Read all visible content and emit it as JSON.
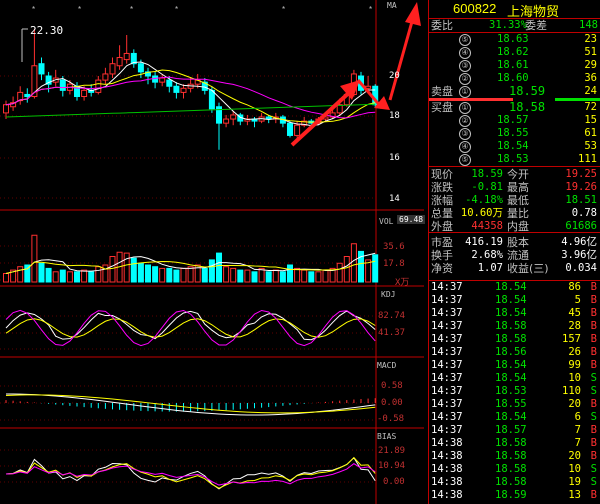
{
  "stock": {
    "code": "600822",
    "name": "上海物贸"
  },
  "chart": {
    "ma_label": "MA",
    "high_marker": "22.30",
    "price_axis": [
      "20",
      "18",
      "16",
      "14"
    ],
    "vol_label": "VOL",
    "vol_value": "69.48",
    "vol_axis": [
      "35.6",
      "17.8"
    ],
    "vol_unit": "X万",
    "kdj_label": "KDJ",
    "kdj_axis": [
      "82.74",
      "41.37"
    ],
    "macd_label": "MACD",
    "macd_axis": [
      "0.58",
      "0.00",
      "-0.58"
    ],
    "bias_label": "BIAS",
    "bias_axis": [
      "21.89",
      "10.94",
      "0.00"
    ],
    "accent_colors": {
      "up": "#ff3030",
      "down": "#00ffff",
      "ma5": "#ffffff",
      "ma10": "#ffff00",
      "ma20": "#ff00ff",
      "ma60": "#00c000"
    }
  },
  "order_book": {
    "weibi_label": "委比",
    "weibi": "31.33%",
    "weicha_label": "委差",
    "weicha": "148",
    "sell_label": "卖盘",
    "buy_label": "买盘",
    "asks": [
      {
        "level": "⑤",
        "price": "18.63",
        "vol": "23"
      },
      {
        "level": "④",
        "price": "18.62",
        "vol": "51"
      },
      {
        "level": "③",
        "price": "18.61",
        "vol": "29"
      },
      {
        "level": "②",
        "price": "18.60",
        "vol": "36"
      },
      {
        "level": "①",
        "price": "18.59",
        "vol": "24"
      }
    ],
    "bids": [
      {
        "level": "①",
        "price": "18.58",
        "vol": "72"
      },
      {
        "level": "②",
        "price": "18.57",
        "vol": "15"
      },
      {
        "level": "③",
        "price": "18.55",
        "vol": "61"
      },
      {
        "level": "④",
        "price": "18.54",
        "vol": "53"
      },
      {
        "level": "⑤",
        "price": "18.53",
        "vol": "111"
      }
    ]
  },
  "quote": {
    "xianjia_label": "现价",
    "xianjia": "18.59",
    "jinkai_label": "今开",
    "jinkai": "19.25",
    "zhangdie_label": "涨跌",
    "zhangdie": "-0.81",
    "zuigao_label": "最高",
    "zuigao": "19.26",
    "zhangfu_label": "涨幅",
    "zhangfu": "-4.18%",
    "zuidi_label": "最低",
    "zuidi": "18.51",
    "zongliang_label": "总量",
    "zongliang": "10.60万",
    "liangbi_label": "量比",
    "liangbi": "0.78",
    "waipan_label": "外盘",
    "waipan": "44358",
    "neipan_label": "内盘",
    "neipan": "61686",
    "shiying_label": "市盈",
    "shiying": "416.19",
    "guben_label": "股本",
    "guben": "4.96亿",
    "huanshou_label": "换手",
    "huanshou": "2.68%",
    "liutong_label": "流通",
    "liutong": "3.96亿",
    "jingzi_label": "净资",
    "jingzi": "1.07",
    "shouyi_label": "收益(三)",
    "shouyi": "0.034"
  },
  "ticks": [
    {
      "time": "14:37",
      "price": "18.54",
      "vol": "86",
      "side": "B"
    },
    {
      "time": "14:37",
      "price": "18.54",
      "vol": "5",
      "side": "B"
    },
    {
      "time": "14:37",
      "price": "18.54",
      "vol": "45",
      "side": "B"
    },
    {
      "time": "14:37",
      "price": "18.58",
      "vol": "28",
      "side": "B"
    },
    {
      "time": "14:37",
      "price": "18.58",
      "vol": "157",
      "side": "B"
    },
    {
      "time": "14:37",
      "price": "18.56",
      "vol": "26",
      "side": "B"
    },
    {
      "time": "14:37",
      "price": "18.54",
      "vol": "99",
      "side": "B"
    },
    {
      "time": "14:37",
      "price": "18.54",
      "vol": "10",
      "side": "S"
    },
    {
      "time": "14:37",
      "price": "18.53",
      "vol": "110",
      "side": "S"
    },
    {
      "time": "14:37",
      "price": "18.55",
      "vol": "20",
      "side": "B"
    },
    {
      "time": "14:37",
      "price": "18.54",
      "vol": "6",
      "side": "S"
    },
    {
      "time": "14:37",
      "price": "18.57",
      "vol": "7",
      "side": "B"
    },
    {
      "time": "14:38",
      "price": "18.58",
      "vol": "7",
      "side": "B"
    },
    {
      "time": "14:38",
      "price": "18.58",
      "vol": "20",
      "side": "B"
    },
    {
      "time": "14:38",
      "price": "18.58",
      "vol": "10",
      "side": "S"
    },
    {
      "time": "14:38",
      "price": "18.58",
      "vol": "19",
      "side": "S"
    },
    {
      "time": "14:38",
      "price": "18.59",
      "vol": "13",
      "side": "B"
    }
  ]
}
